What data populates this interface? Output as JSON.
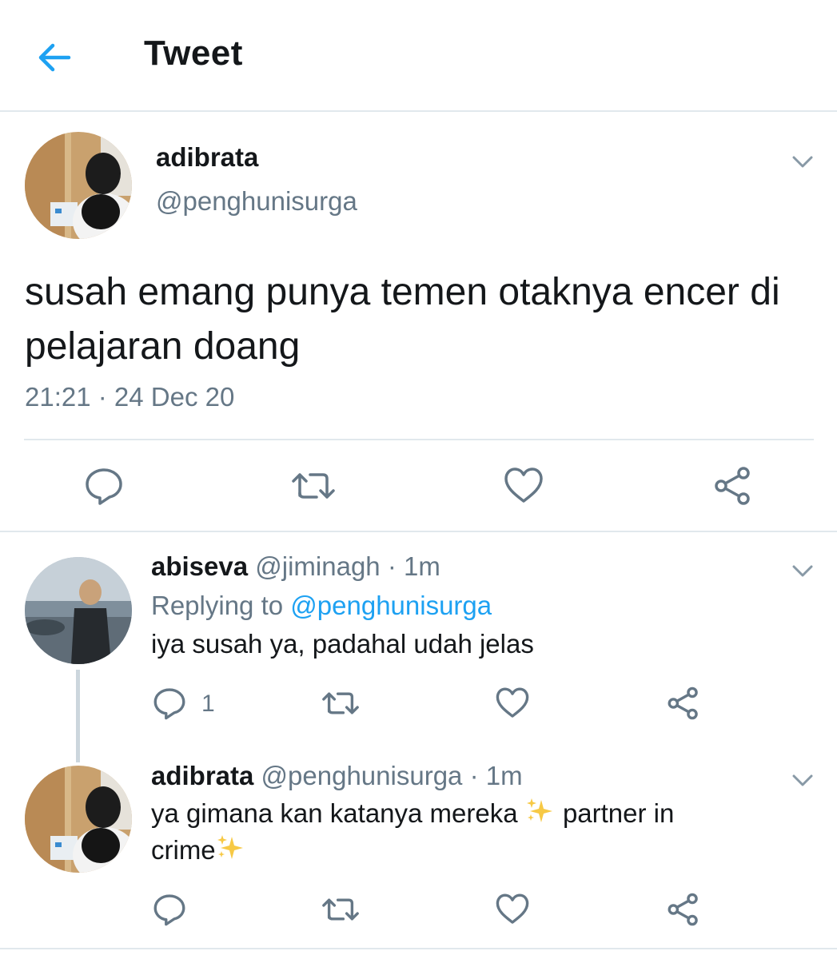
{
  "header": {
    "title": "Tweet",
    "back_icon": "arrow-left-icon",
    "accent_color": "#1da1f2"
  },
  "main_tweet": {
    "display_name": "adibrata",
    "handle": "@penghunisurga",
    "text": "susah emang punya temen otaknya encer di pelajaran doang",
    "timestamp": "21:21 · 24 Dec 20",
    "actions": [
      "reply-icon",
      "retweet-icon",
      "like-icon",
      "share-icon"
    ]
  },
  "replies": [
    {
      "display_name": "abiseva",
      "handle": "@jiminagh",
      "separator": "·",
      "time": "1m",
      "replying_label": "Replying to",
      "replying_to": "@penghunisurga",
      "text": "iya susah ya, padahal udah jelas",
      "reply_count": "1"
    },
    {
      "display_name": "adibrata",
      "handle": "@penghunisurga",
      "separator": "·",
      "time": "1m",
      "text_line1": "ya gimana kan katanya mereka",
      "text_line1_after": "partner in",
      "text_line2": "crime"
    }
  ]
}
